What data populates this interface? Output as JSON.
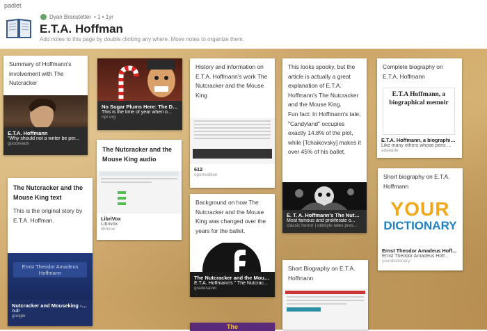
{
  "app": {
    "brand": "padlet"
  },
  "header": {
    "author": "Dyan Branstetter",
    "meta": "• 1 • 1yr",
    "title": "E.T.A. Hoffman",
    "description": "Add notes to this page by double clicking any where. Move notes to organize them."
  },
  "notes": {
    "n1": {
      "text": "Summary of Hoffmann's involvement with The Nutcracker",
      "card_title": "E.T.A. Hoffmann",
      "card_desc": "\"Why should not a writer be per...",
      "card_source": "goodreads"
    },
    "n2": {
      "card_title": "No Sugar Plums Here: The Dar...",
      "card_desc": "This is the time of year when o...",
      "card_source": "npr.org"
    },
    "n3": {
      "text": "History and information on E.T.A. Hoffmann's work The Nutcracker and the Mouse King",
      "card_title": "612",
      "card_source": "openedition"
    },
    "n4": {
      "text": "This looks spooky, but the article is actually a great explanation of E.T.A. Hoffmann's The Nutcracker and the Mouse King.\nFun fact: In Hoffmann's tale, \"Candyland\" occupies exactly 14.8% of the plot, while [Tchaikovsky] makes it over 45% of his ballet.",
      "card_title": "E. T. A. Hoffmann's The Nutcra...",
      "card_desc": "Most famous and proliferate o...",
      "card_source": "classic horror | oldstyle tales pres..."
    },
    "n5": {
      "text": "Complete biography on E.T.A. Hoffmann",
      "img_text": "E.T.A Hoffmann, a biographical memoir",
      "card_title": "E.T.A. Hoffmann, a biographica...",
      "card_desc": "Like many others whose pens ...",
      "card_source": "adelaide"
    },
    "n6": {
      "title": "The Nutcracker and the Mouse King audio",
      "card_title": "LibriVox",
      "card_desc": "Librivox",
      "card_source": "librivox"
    },
    "n7": {
      "title": "The Nutcracker and the Mouse King text",
      "text": "This is the original story by E.T.A. Hoffman.",
      "img_text1": "Ernst Theodor Amadeus",
      "img_text2": "Hoffmann",
      "card_title": "Nutcracker and Mouseking - G...",
      "card_desc": "null",
      "card_source": "google"
    },
    "n8": {
      "text": "Background on how The Nutcracker and the Mouse King was changed over the years for the ballet.",
      "card_title": "The Nutcracker and the Mous...",
      "card_desc": "E.T.A. Hoffmann's \" The Nutcrac...",
      "card_source": "gradesaver",
      "bottom_text": "The"
    },
    "n9": {
      "text": "Short Biography on E.T.A. Hoffmann"
    },
    "n10": {
      "text": "Short biography on E.T.A. Hoffmann",
      "logo1": "YOUR",
      "logo2": "DICTIONARY",
      "card_title": "Ernst Theodor Amadeus Hoff...",
      "card_desc": "Ernst Theodor Amadeus Hoff...",
      "card_source": "yourdictionary"
    }
  }
}
